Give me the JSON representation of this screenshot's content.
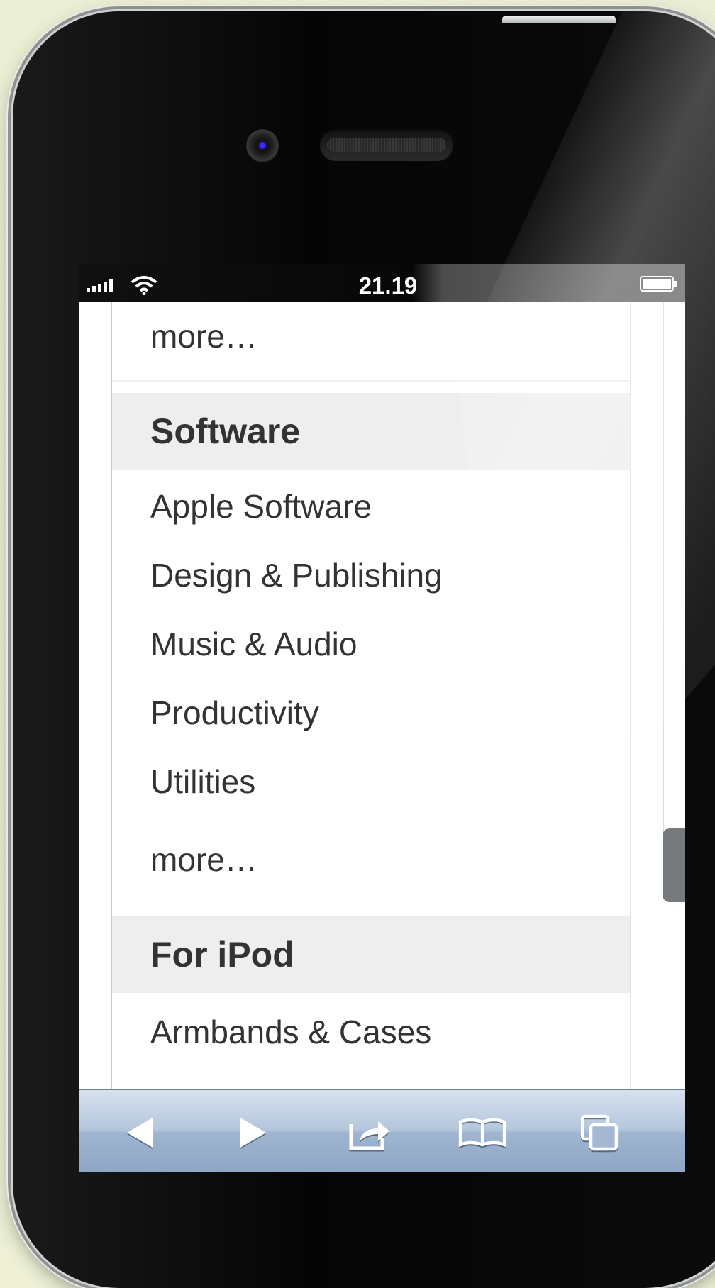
{
  "status_bar": {
    "time": "21.19",
    "signal_icon": "signal-bars-icon",
    "wifi_icon": "wifi-icon",
    "battery_icon": "battery-icon"
  },
  "menu": {
    "top_more": "more…",
    "sections": [
      {
        "title": "Software",
        "items": [
          "Apple Software",
          "Design & Publishing",
          "Music & Audio",
          "Productivity",
          "Utilities",
          "more…"
        ]
      },
      {
        "title": "For iPod",
        "items": [
          "Armbands & Cases"
        ]
      }
    ]
  },
  "toolbar": {
    "buttons": [
      {
        "icon": "back-arrow-icon"
      },
      {
        "icon": "forward-arrow-icon"
      },
      {
        "icon": "share-icon"
      },
      {
        "icon": "bookmarks-icon"
      },
      {
        "icon": "tabs-icon"
      }
    ]
  },
  "colors": {
    "page_background": "#eef1d6",
    "section_header_bg": "#eeeeee",
    "text": "#333333",
    "toolbar_top": "#d7e1ef",
    "toolbar_bottom": "#8ea7c5"
  }
}
